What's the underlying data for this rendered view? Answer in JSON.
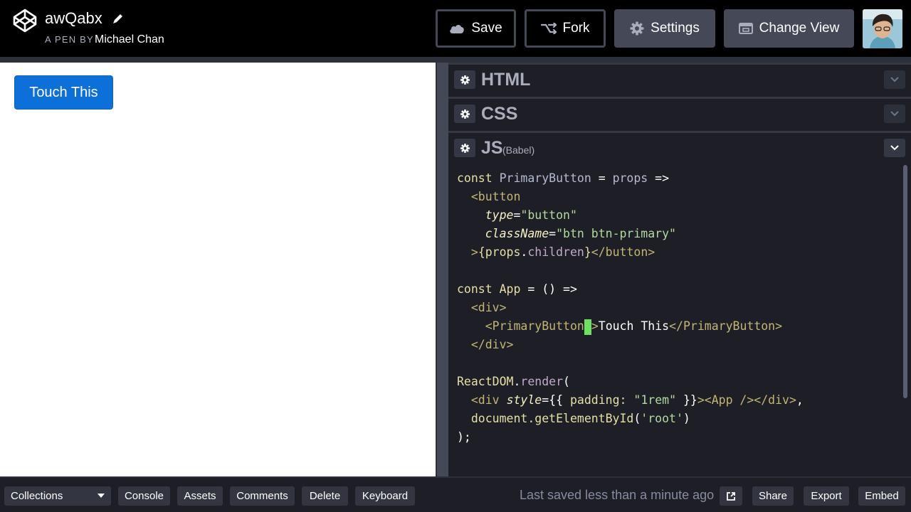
{
  "header": {
    "pen_title": "awQabx",
    "pen_by_label": "A PEN BY",
    "author": "Michael Chan",
    "buttons": {
      "save": "Save",
      "fork": "Fork",
      "settings": "Settings",
      "change_view": "Change View"
    }
  },
  "preview": {
    "button_label": "Touch This"
  },
  "editors": {
    "html": {
      "title": "HTML"
    },
    "css": {
      "title": "CSS"
    },
    "js": {
      "title": "JS",
      "subtitle": "(Babel)"
    }
  },
  "footer": {
    "collections": "Collections",
    "console": "Console",
    "assets": "Assets",
    "comments": "Comments",
    "delete": "Delete",
    "keyboard": "Keyboard",
    "saved_status": "Last saved less than a minute ago",
    "share": "Share",
    "export": "Export",
    "embed": "Embed"
  },
  "colors": {
    "header_bg": "#000000",
    "editor_bg": "#1e1f26",
    "button_gray": "#444857",
    "preview_button": "#0d6fd8",
    "cursor": "#6fe160"
  },
  "icons": {
    "logo": "codepen-logo-icon",
    "edit": "pencil-icon",
    "save": "cloud-icon",
    "fork": "fork-icon",
    "settings": "gear-icon",
    "change_view": "layout-icon",
    "external": "external-link-icon"
  }
}
